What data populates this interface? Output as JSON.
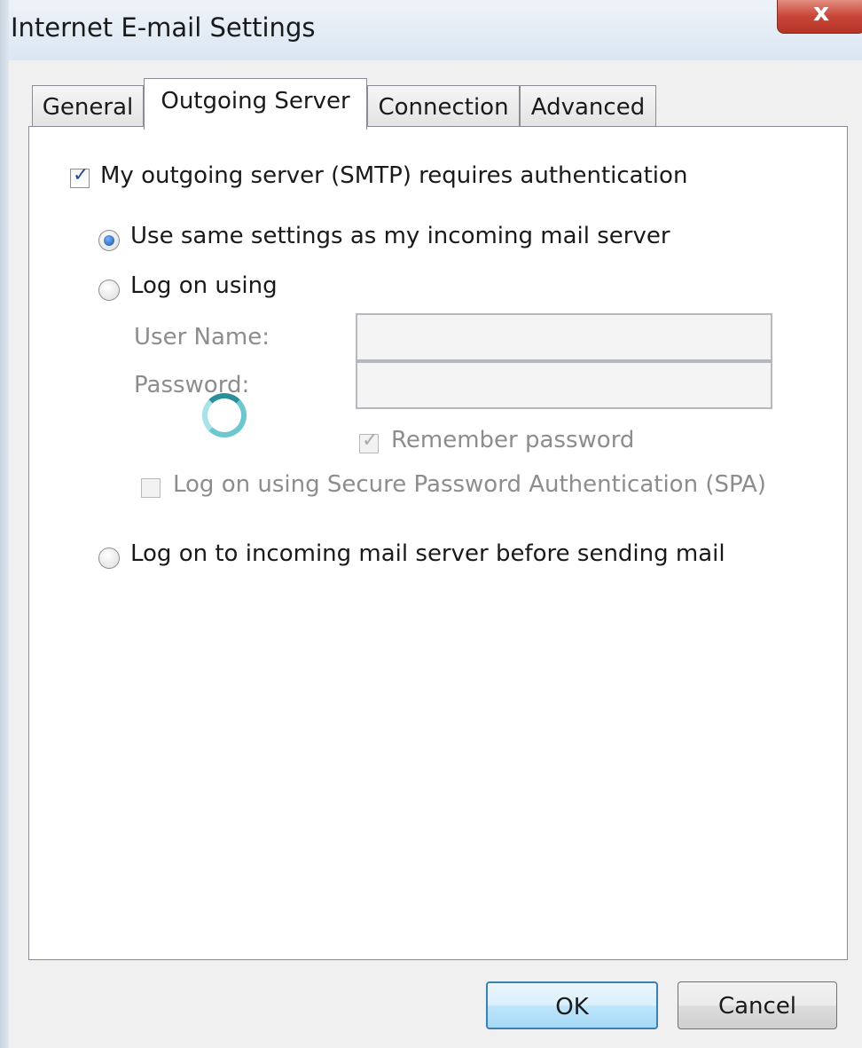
{
  "window": {
    "title": "Internet E-mail Settings",
    "close_label": "x"
  },
  "tabs": [
    {
      "label": "General",
      "active": false
    },
    {
      "label": "Outgoing Server",
      "active": true
    },
    {
      "label": "Connection",
      "active": false
    },
    {
      "label": "Advanced",
      "active": false
    }
  ],
  "outgoing": {
    "requires_auth": {
      "label": "My outgoing server (SMTP) requires authentication",
      "checked": true
    },
    "use_same": {
      "label": "Use same settings as my incoming mail server",
      "selected": true
    },
    "log_on_using": {
      "label": "Log on using",
      "selected": false
    },
    "user_name": {
      "label": "User Name:",
      "value": ""
    },
    "password": {
      "label": "Password:",
      "value": ""
    },
    "remember_password": {
      "label": "Remember password",
      "checked": true,
      "enabled": false
    },
    "spa": {
      "label": "Log on using Secure Password Authentication (SPA)",
      "checked": false,
      "enabled": false
    },
    "log_on_incoming": {
      "label": "Log on to incoming mail server before sending mail",
      "selected": false
    }
  },
  "buttons": {
    "ok": "OK",
    "cancel": "Cancel"
  }
}
